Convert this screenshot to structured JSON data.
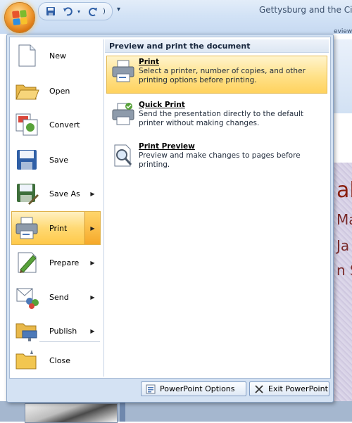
{
  "window": {
    "doc_title": "Gettysburg and the Civil",
    "ribbon_tab_fragment": "eview"
  },
  "quick_access": {
    "items": [
      "save-icon",
      "undo-icon",
      "redo-icon",
      "customize-dropdown"
    ],
    "dropdown_glyph": "▾"
  },
  "office_menu": {
    "left_items": [
      {
        "label": "New",
        "icon": "new-document-icon",
        "has_submenu": false
      },
      {
        "label": "Open",
        "icon": "open-folder-icon",
        "has_submenu": false
      },
      {
        "label": "Convert",
        "icon": "convert-icon",
        "has_submenu": false
      },
      {
        "label": "Save",
        "icon": "save-icon",
        "has_submenu": false
      },
      {
        "label": "Save As",
        "icon": "save-as-icon",
        "has_submenu": true
      },
      {
        "label": "Print",
        "icon": "printer-icon",
        "has_submenu": true,
        "active": true
      },
      {
        "label": "Prepare",
        "icon": "prepare-icon",
        "has_submenu": true
      },
      {
        "label": "Send",
        "icon": "send-icon",
        "has_submenu": true
      },
      {
        "label": "Publish",
        "icon": "publish-icon",
        "has_submenu": true
      },
      {
        "label": "Close",
        "icon": "close-folder-icon",
        "has_submenu": false
      }
    ],
    "panel": {
      "header": "Preview and print the document",
      "options": [
        {
          "title": "Print",
          "description": "Select a printer, number of copies, and other printing options before printing.",
          "icon": "printer-icon",
          "active": true
        },
        {
          "title": "Quick Print",
          "description": "Send the presentation directly to the default printer without making changes.",
          "icon": "quick-print-icon",
          "active": false
        },
        {
          "title": "Print Preview",
          "description": "Preview and make changes to pages before printing.",
          "icon": "print-preview-icon",
          "active": false
        }
      ]
    },
    "footer": {
      "options_label": "PowerPoint Options",
      "exit_label": "Exit PowerPoint"
    }
  },
  "slide_fragments": {
    "big": "al",
    "line1": "Ma",
    "line2": "Ja",
    "line3": "n S"
  },
  "colors": {
    "highlight": "#ffd56b",
    "menu_border": "#8aa5c8",
    "title_text": "#8a1f0f"
  }
}
